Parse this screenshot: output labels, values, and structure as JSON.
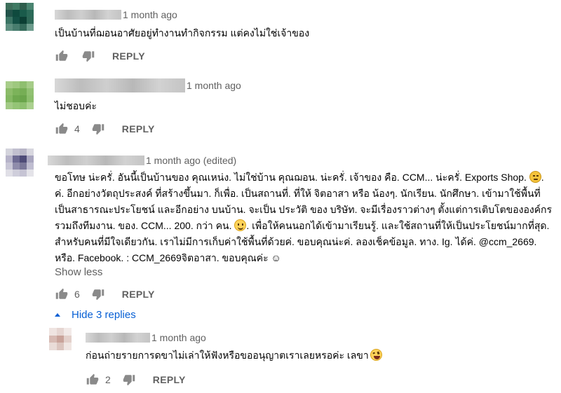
{
  "comments": [
    {
      "timestamp": "1 month ago",
      "text": "เป็นบ้านที่ฌอนอาศัยอยู่ทำงานทำกิจกรรม แต่คงไม่ใช่เจ้าของ",
      "likes": "",
      "reply_label": "REPLY"
    },
    {
      "timestamp": "1 month ago",
      "text": "ไม่ชอบค่ะ",
      "likes": "4",
      "reply_label": "REPLY"
    },
    {
      "timestamp": "1 month ago (edited)",
      "text_part1": "ขอโทษ น่ะครั่. อันนี้เป็นบ้านของ คุณเหน่ง. ไม่ใช่บ้าน คุณฌอน.   น่ะครั่.  เจ้าของ คือ.  CCM...  น่ะครั่.     Exports Shop. ",
      "text_part2": ". ค่. อีกอย่างวัตถุประสงค์  ที่สร้างขึ้นมา. ก็เพื่อ. เป็นสถานที่. ที่ให้ จิตอาสา หรือ น้องๆ. นักเรียน. นักศึกษา. เข้ามาใช้พื้นที่ เป็นสาธารณะประโยชน์  และอีกอย่าง บนบ้าน. จะเป็น ประวัติ ของ บริษัท.  จะมีเรื่องราวต่างๆ  ตั้งแต่การเติบโตขององค์กร  รวมถึงทีมงาน. ของ. CCM...  200. กว่า คน.   ",
      "text_part3": ".    เพื่อให้คนนอกได้เข้ามาเรียนรู้. และใช้สถานที่ให้เป็นประโยชน์มากที่สุด.  สำหรับคนที่มีใจเดียวกัน.  เราไม่มีการเก็บค่าใช้พื้นที่ด้วยค่.   ขอบคุณน่ะค่.   ลองเช็คข้อมูล. ทาง. Ig.  ได้ค่. @ccm_2669.   หรือ.  Facebook. :  CCM_2669จิตอาสา.    ขอบคุณค่ะ ☺",
      "show_less_label": "Show less",
      "likes": "6",
      "reply_label": "REPLY",
      "hide_replies_label": "Hide 3 replies"
    }
  ],
  "reply": {
    "timestamp": "1 month ago",
    "text": "ก่อนถ่ายรายการดขาไม่เล่าให้ฟังหรือขออนุญาตเราเลยหรอค่ะ เลขา",
    "likes": "2",
    "reply_label": "REPLY"
  },
  "icons": {
    "like": "thumbs-up-icon",
    "dislike": "thumbs-down-icon",
    "caret": "caret-up-icon"
  },
  "colors": {
    "link": "#065fd4",
    "secondary_text": "#606060",
    "icon": "#8a8a8a"
  }
}
